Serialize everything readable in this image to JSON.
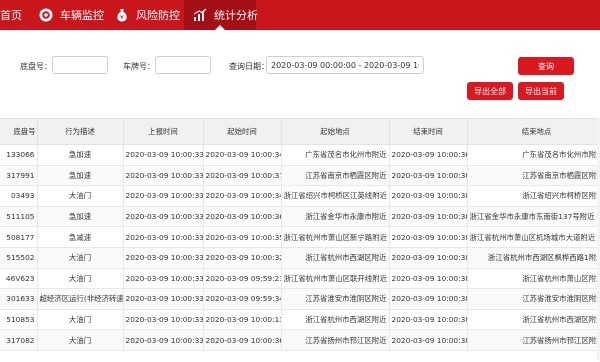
{
  "nav": {
    "items": [
      {
        "label": "首页",
        "icon": "home-icon"
      },
      {
        "label": "车辆监控",
        "icon": "monitor-target-icon"
      },
      {
        "label": "风险防控",
        "icon": "money-bag-icon"
      },
      {
        "label": "统计分析",
        "icon": "bar-chart-icon",
        "active": true
      }
    ]
  },
  "filter": {
    "chassis_label": "底盘号：",
    "chassis_value": "",
    "plate_label": "车牌号：",
    "plate_value": "",
    "date_label": "查询日期：",
    "date_value": "2020-03-09 00:00:00 - 2020-03-09 10:16:02",
    "search_button": "查询",
    "export_all_button": "导出全部",
    "export_current_button": "导出当前"
  },
  "table": {
    "columns": [
      "底盘号",
      "行为描述",
      "上报时间",
      "起始时间",
      "起始地点",
      "结束时间",
      "结束地点"
    ],
    "rows": [
      [
        "133066",
        "急加速",
        "2020-03-09 10:00:33",
        "2020-03-09 10:00:34",
        "广东省茂名市化州市附近",
        "2020-03-09 10:00:36",
        "广东省茂名市化州市附近"
      ],
      [
        "317991",
        "急加速",
        "2020-03-09 10:00:33",
        "2020-03-09 10:00:37",
        "江苏省南京市栖霞区附近",
        "2020-03-09 10:00:38",
        "江苏省南京市栖霞区附近"
      ],
      [
        "03493",
        "大油门",
        "2020-03-09 10:00:33",
        "2020-03-09 10:00:34",
        "浙江省绍兴市柯桥区江英线附近",
        "2020-03-09 10:00:38",
        "浙江省绍兴市柯桥区附近"
      ],
      [
        "511105",
        "急加速",
        "2020-03-09 10:00:33",
        "2020-03-09 10:00:36",
        "浙江省金华市永康市附近",
        "2020-03-09 10:00:38",
        "浙江省金华市永康市东南街137号附近"
      ],
      [
        "508177",
        "急减速",
        "2020-03-09 10:00:33",
        "2020-03-09 10:00:35",
        "浙江省杭州市萧山区新宁路附近",
        "2020-03-09 10:00:38",
        "浙江省杭州市萧山区机场城市大道附近"
      ],
      [
        "515502",
        "大油门",
        "2020-03-09 10:00:33",
        "2020-03-09 10:00:32",
        "浙江省杭州市西湖区附近",
        "2020-03-09 10:00:38",
        "浙江省杭州市西湖区枫桦西路1附近"
      ],
      [
        "46V623",
        "大油门",
        "2020-03-09 10:00:33",
        "2020-03-09 09:59:23",
        "浙江省杭州市萧山区联开线附近",
        "2020-03-09 10:00:38",
        "浙江省杭州市萧山区附近"
      ],
      [
        "301633",
        "超经济区运行(非经济转速)",
        "2020-03-09 10:00:33",
        "2020-03-09 09:59:34",
        "江苏省淮安市淮阴区附近",
        "2020-03-09 10:00:38",
        "江苏省淮安市淮阴区附近"
      ],
      [
        "510853",
        "大油门",
        "2020-03-09 10:00:33",
        "2020-03-09 10:00:13",
        "浙江省杭州市西湖区附近",
        "2020-03-09 10:00:38",
        "浙江省杭州市西湖区附近"
      ],
      [
        "317082",
        "大油门",
        "2020-03-09 10:00:33",
        "2020-03-09 10:00:36",
        "江苏省扬州市邗江区附近",
        "2020-03-09 10:00:38",
        "江苏省扬州市邗江区附近"
      ]
    ]
  },
  "colors": {
    "accent": "#c9161d",
    "active_tab": "#a40f15",
    "button": "#d9181f",
    "header_bg": "#f1f1f1"
  }
}
